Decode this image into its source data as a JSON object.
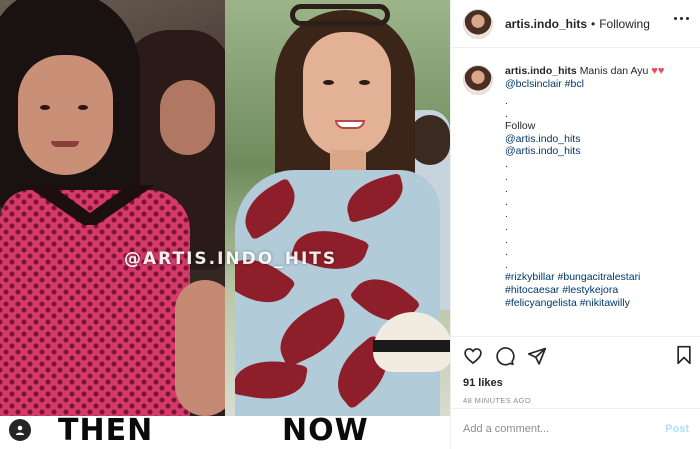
{
  "post": {
    "watermark": "@ARTIS.INDO_HITS",
    "then_label": "THEN",
    "now_label": "NOW"
  },
  "header": {
    "username": "artis.indo_hits",
    "separator": "•",
    "follow_status": "Following"
  },
  "caption": {
    "username": "artis.indo_hits",
    "text": "Manis dan Ayu",
    "hearts": "♥♥",
    "mentions": "@bclsinclair #bcl",
    "lines": [
      ".",
      ".",
      "Follow",
      "@artis.indo_hits",
      "@artis.indo_hits",
      ".",
      ".",
      ".",
      ".",
      ".",
      ".",
      ".",
      ".",
      ".",
      "#rizkybillar #bungacitralestari",
      "#hitocaesar #lestykejora",
      "#felicyangelista #nikitawilly"
    ]
  },
  "actions": {
    "likes": "91 likes",
    "timestamp": "48 MINUTES AGO"
  },
  "comment_box": {
    "placeholder": "Add a comment...",
    "post_label": "Post"
  },
  "colors": {
    "link": "#00376b",
    "heart": "#ed4956",
    "post_disabled": "#b2dffc",
    "text": "#262626",
    "muted": "#8e8e8e"
  }
}
